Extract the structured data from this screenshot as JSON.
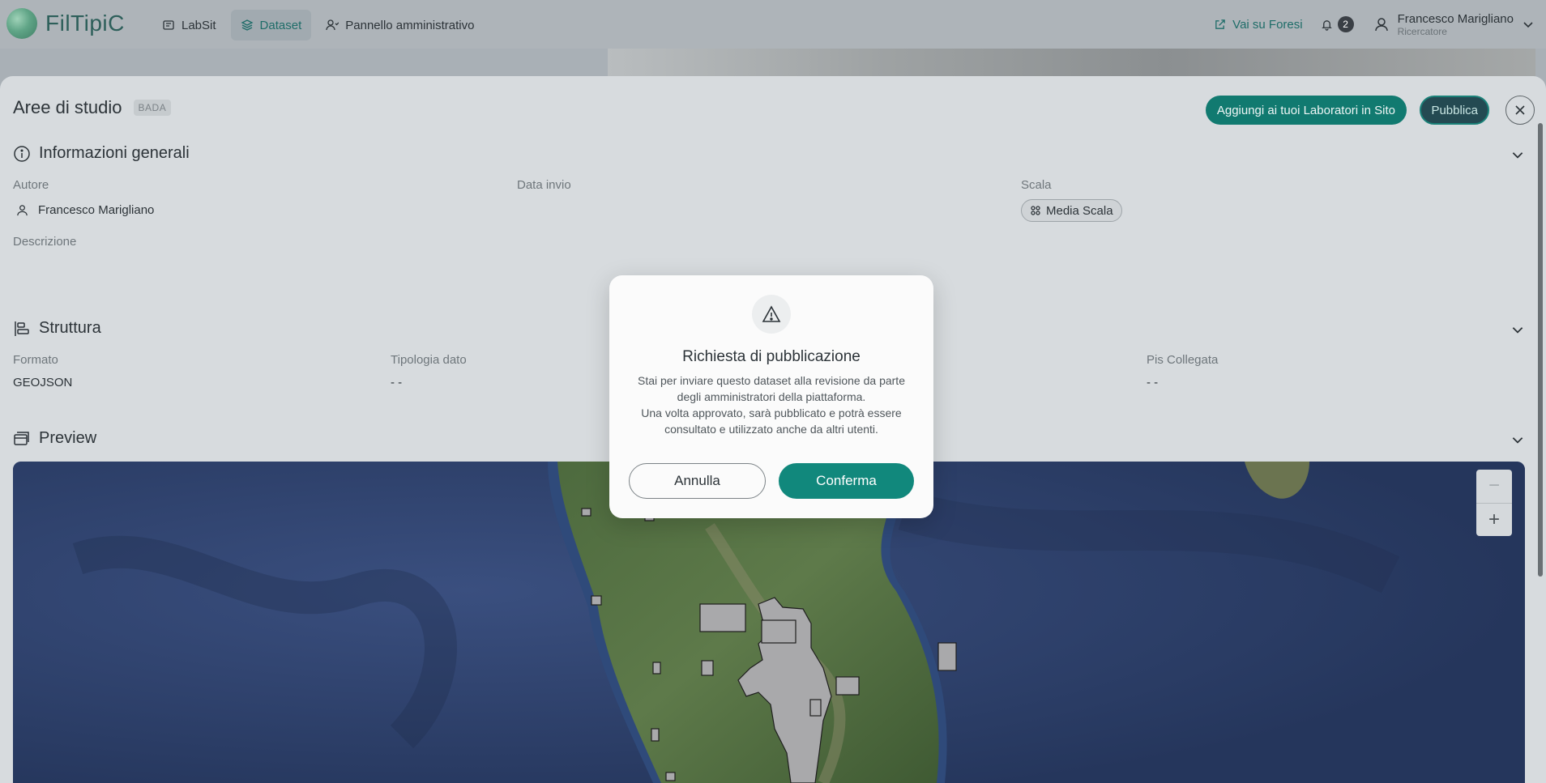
{
  "app": {
    "name": "FilTipiC"
  },
  "nav": {
    "items": [
      {
        "label": "LabSit",
        "active": false
      },
      {
        "label": "Dataset",
        "active": true
      },
      {
        "label": "Pannello amministrativo",
        "active": false
      }
    ]
  },
  "topbar": {
    "external_link": "Vai su Foresi",
    "notifications_count": "2",
    "user_name": "Francesco Marigliano",
    "user_role": "Ricercatore"
  },
  "page": {
    "title": "Aree di studio",
    "tag": "BADA",
    "add_button": "Aggiungi ai tuoi Laboratori in Sito",
    "publish_button": "Pubblica"
  },
  "general_info": {
    "title": "Informazioni generali",
    "author_label": "Autore",
    "author_value": "Francesco Marigliano",
    "date_label": "Data invio",
    "scale_label": "Scala",
    "scale_value": "Media Scala",
    "description_label": "Descrizione"
  },
  "structure": {
    "title": "Struttura",
    "format_label": "Formato",
    "format_value": "GEOJSON",
    "type_label": "Tipologia dato",
    "type_value": "- -",
    "pis_label": "Pis Collegata",
    "pis_value": "- -"
  },
  "preview": {
    "title": "Preview",
    "zoom_out": "−",
    "zoom_in": "+"
  },
  "modal": {
    "title": "Richiesta di pubblicazione",
    "line1": "Stai per inviare questo dataset alla revisione da parte degli amministratori della piattaforma.",
    "line2": "Una volta approvato, sarà pubblicato e potrà essere consultato e utilizzato anche da altri utenti.",
    "cancel": "Annulla",
    "confirm": "Conferma"
  },
  "colors": {
    "accent": "#11887c",
    "dark_teal": "#244a52",
    "panel_bg": "#d7dbde",
    "sea": "#2b3e67"
  }
}
